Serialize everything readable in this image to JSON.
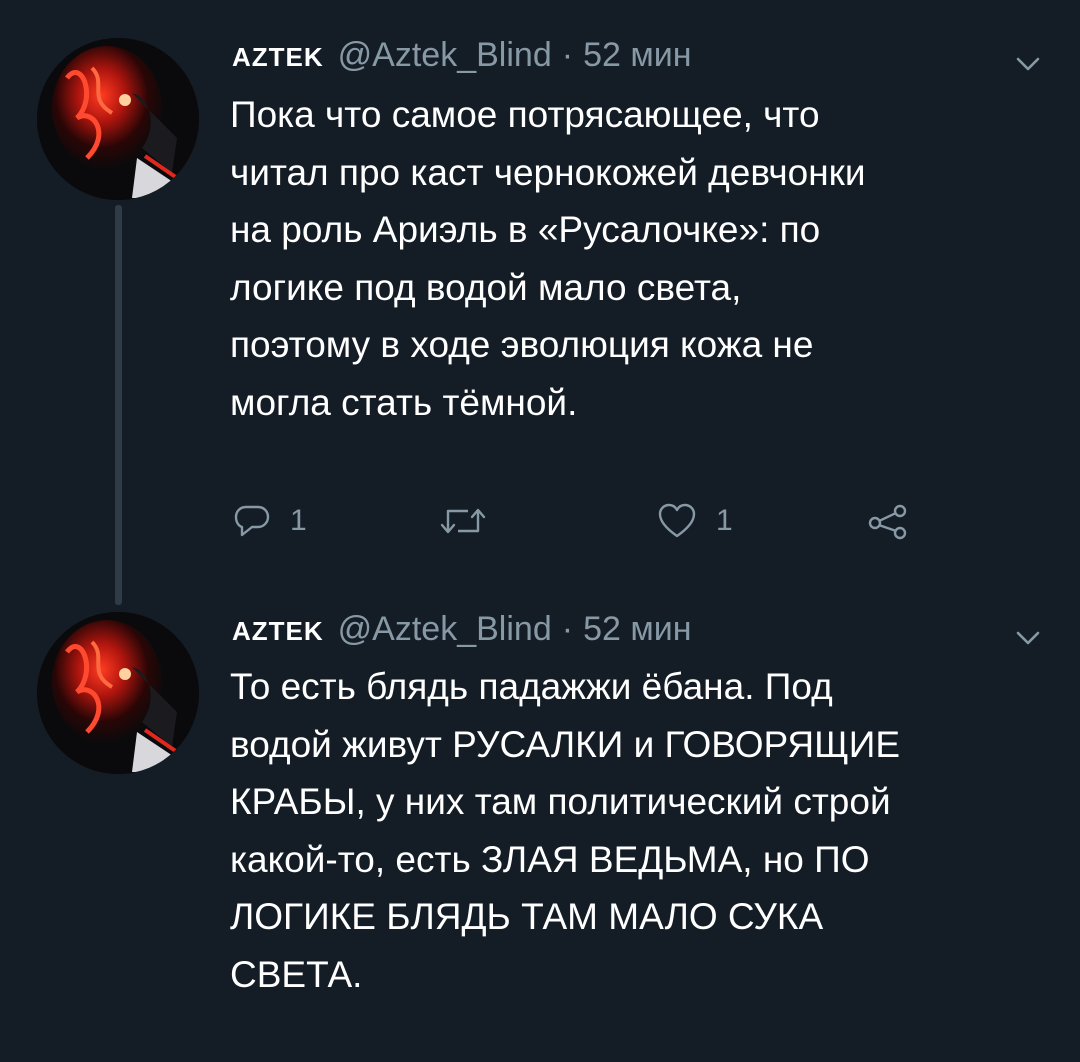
{
  "tweets": [
    {
      "display_name": "AZTEK",
      "handle": "@Aztek_Blind",
      "separator": "·",
      "time": "52 мин",
      "text": "Пока что самое потрясающее, что\nчитал про каст чернокожей девчонки\nна роль Ариэль в «Русалочке»: по\nлогике под водой мало света,\nпоэтому в ходе эволюция кожа не\nмогла стать тёмной.",
      "reply_count": "1",
      "like_count": "1"
    },
    {
      "display_name": "AZTEK",
      "handle": "@Aztek_Blind",
      "separator": "·",
      "time": "52 мин",
      "text": "То есть блядь падажжи ёбана. Под\nводой живут РУСАЛКИ и ГОВОРЯЩИЕ\nКРАБЫ, у них там политический строй\nкакой-то, есть ЗЛАЯ ВЕДЬМА, но ПО\nЛОГИКЕ БЛЯДЬ ТАМ МАЛО СУКА\nСВЕТА."
    }
  ],
  "icons": {
    "reply": "reply-icon",
    "retweet": "retweet-icon",
    "like": "like-icon",
    "share": "share-icon",
    "caret": "chevron-down-icon"
  },
  "colors": {
    "background": "#141d26",
    "text": "#ffffff",
    "muted": "#8899a6",
    "thread_line": "#2f3b48",
    "avatar_accent": "#e0281e"
  }
}
